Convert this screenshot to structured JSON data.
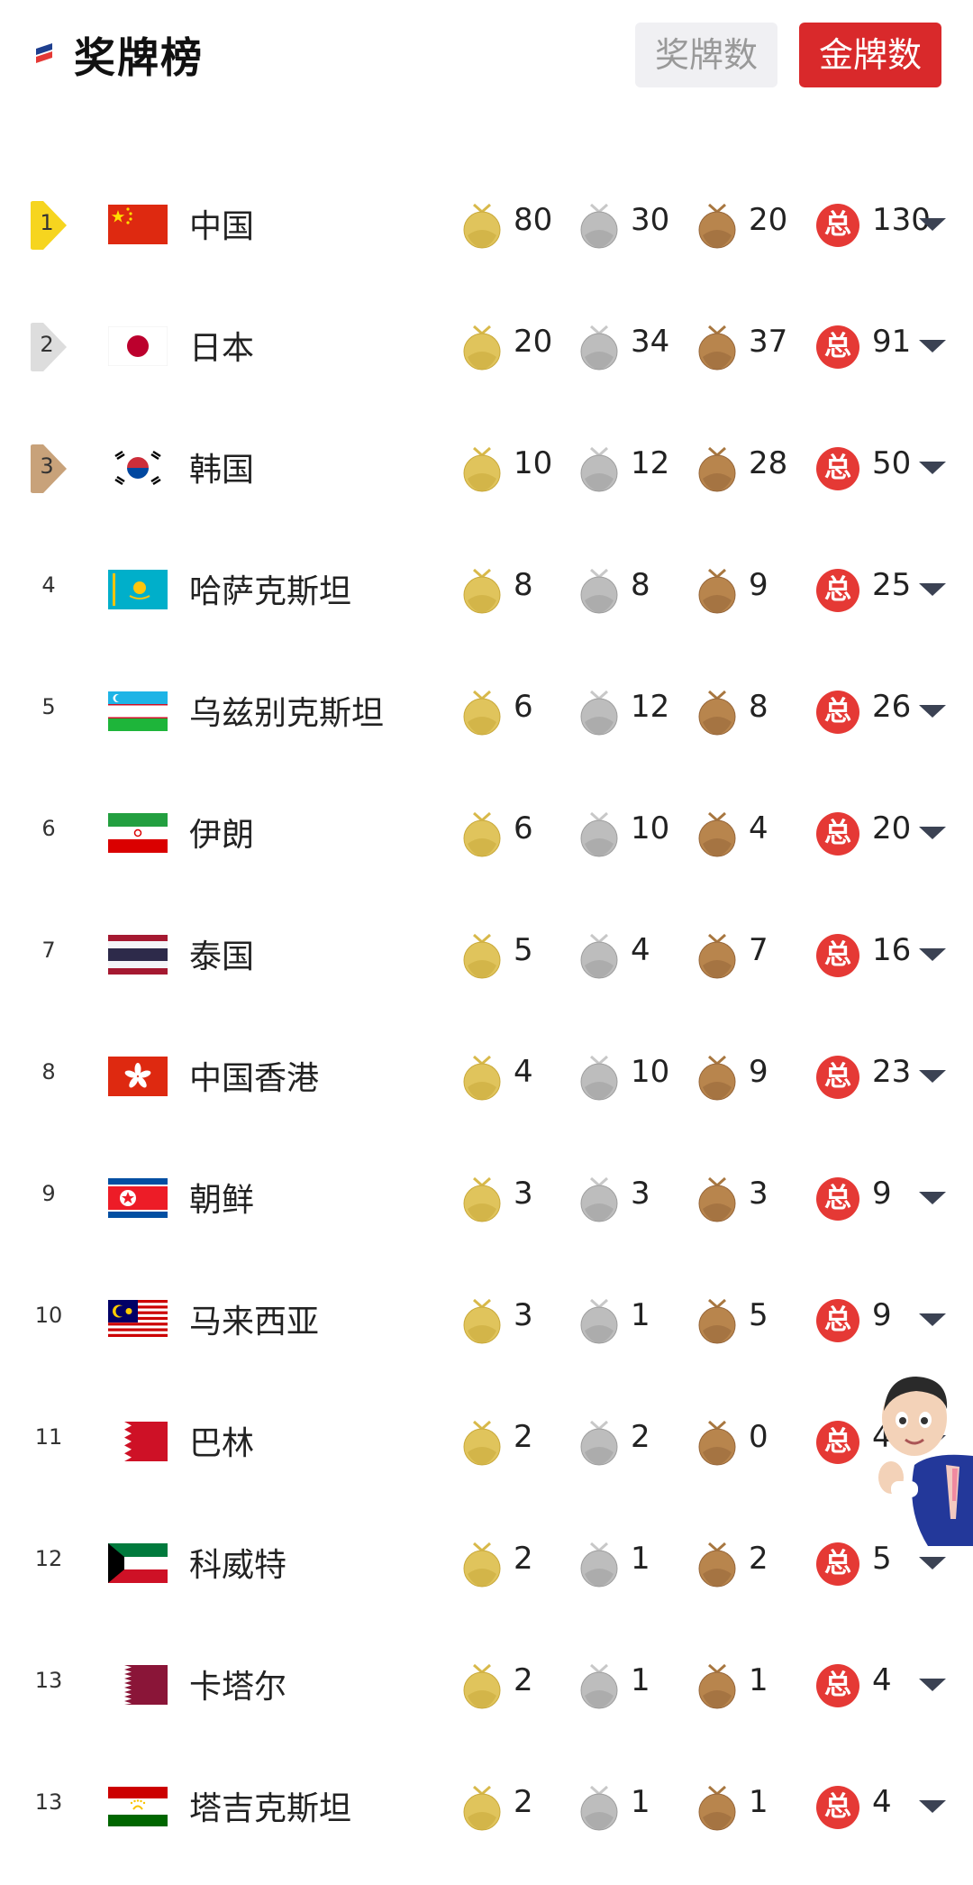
{
  "header": {
    "title": "奖牌榜",
    "sort_options": [
      "奖牌数",
      "金牌数"
    ],
    "selected_sort": "金牌数"
  },
  "total_icon_label": "总",
  "rows": [
    {
      "rank": "1",
      "country": "中国",
      "gold": "80",
      "silver": "30",
      "bronze": "20",
      "total": "130"
    },
    {
      "rank": "2",
      "country": "日本",
      "gold": "20",
      "silver": "34",
      "bronze": "37",
      "total": "91"
    },
    {
      "rank": "3",
      "country": "韩国",
      "gold": "10",
      "silver": "12",
      "bronze": "28",
      "total": "50"
    },
    {
      "rank": "4",
      "country": "哈萨克斯坦",
      "gold": "8",
      "silver": "8",
      "bronze": "9",
      "total": "25"
    },
    {
      "rank": "5",
      "country": "乌兹别克斯坦",
      "gold": "6",
      "silver": "12",
      "bronze": "8",
      "total": "26"
    },
    {
      "rank": "6",
      "country": "伊朗",
      "gold": "6",
      "silver": "10",
      "bronze": "4",
      "total": "20"
    },
    {
      "rank": "7",
      "country": "泰国",
      "gold": "5",
      "silver": "4",
      "bronze": "7",
      "total": "16"
    },
    {
      "rank": "8",
      "country": "中国香港",
      "gold": "4",
      "silver": "10",
      "bronze": "9",
      "total": "23"
    },
    {
      "rank": "9",
      "country": "朝鲜",
      "gold": "3",
      "silver": "3",
      "bronze": "3",
      "total": "9"
    },
    {
      "rank": "10",
      "country": "马来西亚",
      "gold": "3",
      "silver": "1",
      "bronze": "5",
      "total": "9"
    },
    {
      "rank": "11",
      "country": "巴林",
      "gold": "2",
      "silver": "2",
      "bronze": "0",
      "total": "4"
    },
    {
      "rank": "12",
      "country": "科威特",
      "gold": "2",
      "silver": "1",
      "bronze": "2",
      "total": "5"
    },
    {
      "rank": "13",
      "country": "卡塔尔",
      "gold": "2",
      "silver": "1",
      "bronze": "1",
      "total": "4"
    },
    {
      "rank": "13",
      "country": "塔吉克斯坦",
      "gold": "2",
      "silver": "1",
      "bronze": "1",
      "total": "4"
    }
  ],
  "colors": {
    "accent_red": "#d9292b",
    "total_badge": "#e53935",
    "gold_medal": "#e0c45c",
    "silver_medal": "#bdbdbd",
    "bronze_medal": "#b8854d",
    "rank1_badge": "#f6d51f",
    "rank2_badge": "#dddddd",
    "rank3_badge": "#c8a27a"
  }
}
